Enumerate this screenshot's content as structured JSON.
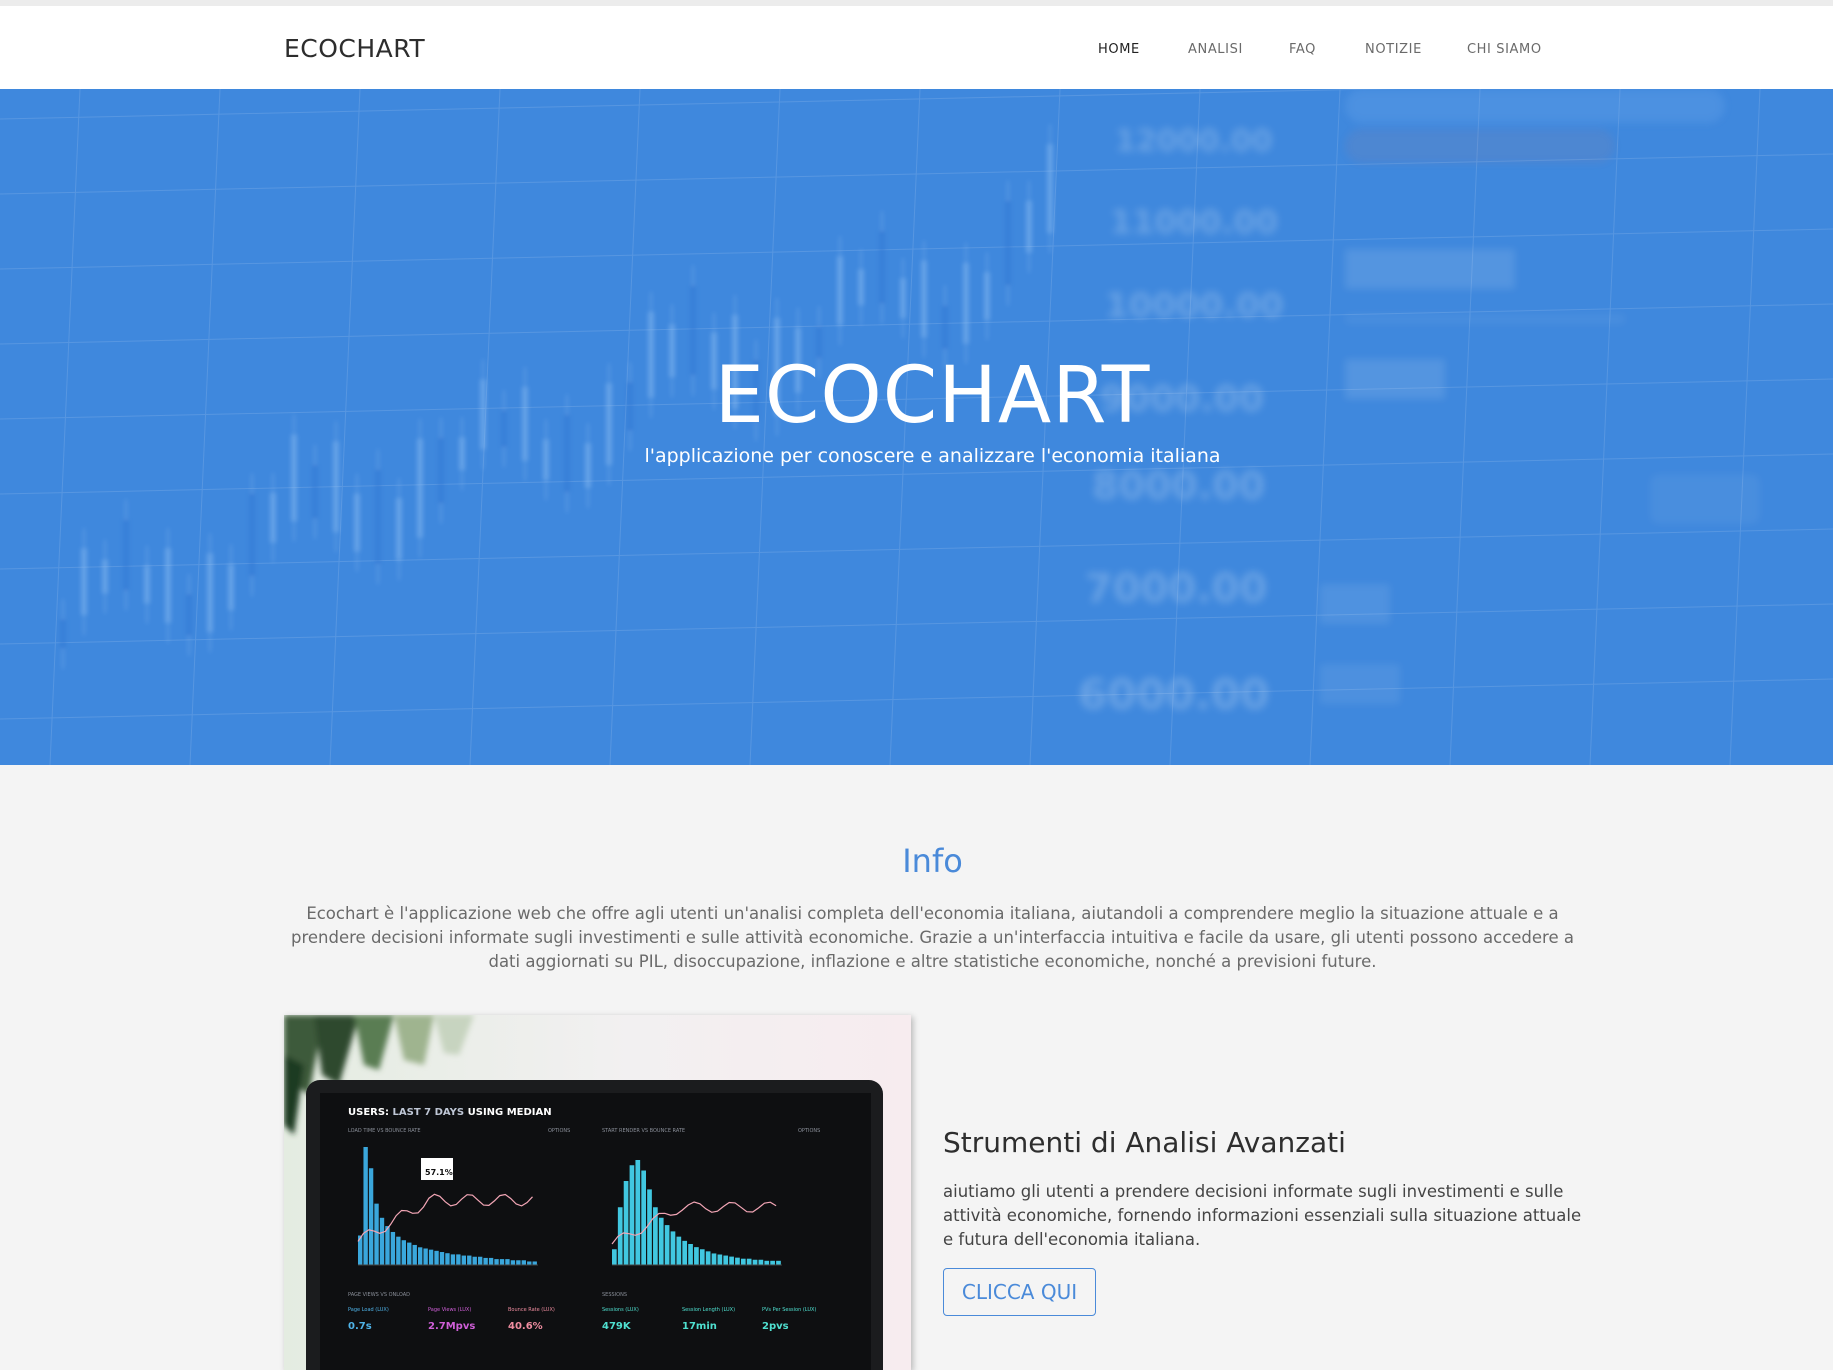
{
  "nav": {
    "brand": "ECOCHART",
    "links": [
      "HOME",
      "ANALISI",
      "FAQ",
      "NOTIZIE",
      "CHI SIAMO"
    ]
  },
  "hero": {
    "title": "ECOCHART",
    "subtitle": "l'applicazione per conoscere e analizzare l'economia italiana",
    "bg_numbers": [
      "12000.00",
      "11000.00",
      "10000.00",
      "9000.00",
      "8000.00",
      "7000.00",
      "6000.00"
    ]
  },
  "info": {
    "title": "Info",
    "text": "Ecochart è l'applicazione web che offre agli utenti un'analisi completa dell'economia italiana, aiutandoli a comprendere meglio la situazione attuale e a prendere decisioni informate sugli investimenti e sulle attività economiche. Grazie a un'interfaccia intuitiva e facile da usare, gli utenti possono accedere a dati aggiornati su PIL, disoccupazione, inflazione e altre statistiche economiche, nonché a previsioni future."
  },
  "feature": {
    "title": "Strumenti di Analisi Avanzati",
    "text": "aiutiamo gli utenti a prendere decisioni informate sugli investimenti e sulle attività economiche, fornendo informazioni essenziali sulla situazione attuale e futura dell'economia italiana.",
    "button": "CLICCA QUI"
  },
  "laptop": {
    "header_prefix": "USERS: ",
    "header_mid": "LAST 7 DAYS",
    "header_suffix": " USING MEDIAN",
    "panel1": "LOAD TIME VS BOUNCE RATE",
    "panel2": "START RENDER VS BOUNCE RATE",
    "options": "OPTIONS",
    "callout": "57.1%",
    "page_views": "PAGE VIEWS VS ONLOAD",
    "sessions": "SESSIONS",
    "stats": [
      {
        "label": "Page Load (LUX)",
        "value": "0.7s",
        "color": "#4fb3e8"
      },
      {
        "label": "Page Views (LUX)",
        "value": "2.7Mpvs",
        "color": "#d05fd8"
      },
      {
        "label": "Bounce Rate (LUX)",
        "value": "40.6%",
        "color": "#f08da0"
      },
      {
        "label": "Sessions (LUX)",
        "value": "479K",
        "color": "#4fe0d0"
      },
      {
        "label": "Session Length (LUX)",
        "value": "17min",
        "color": "#4fe0d0"
      },
      {
        "label": "PVs Per Session (LUX)",
        "value": "2pvs",
        "color": "#4fe0d0"
      }
    ],
    "hist_left": [
      0.25,
      1.0,
      0.82,
      0.52,
      0.4,
      0.33,
      0.28,
      0.24,
      0.21,
      0.19,
      0.17,
      0.15,
      0.14,
      0.13,
      0.12,
      0.11,
      0.1,
      0.09,
      0.09,
      0.08,
      0.08,
      0.07,
      0.07,
      0.06,
      0.06,
      0.05,
      0.05,
      0.05,
      0.04,
      0.04,
      0.04,
      0.03,
      0.03
    ],
    "hist_right": [
      0.15,
      0.55,
      0.8,
      0.95,
      1.0,
      0.9,
      0.72,
      0.55,
      0.45,
      0.38,
      0.32,
      0.27,
      0.23,
      0.2,
      0.17,
      0.15,
      0.13,
      0.11,
      0.1,
      0.09,
      0.08,
      0.07,
      0.06,
      0.06,
      0.05,
      0.05,
      0.04,
      0.04,
      0.04
    ]
  }
}
